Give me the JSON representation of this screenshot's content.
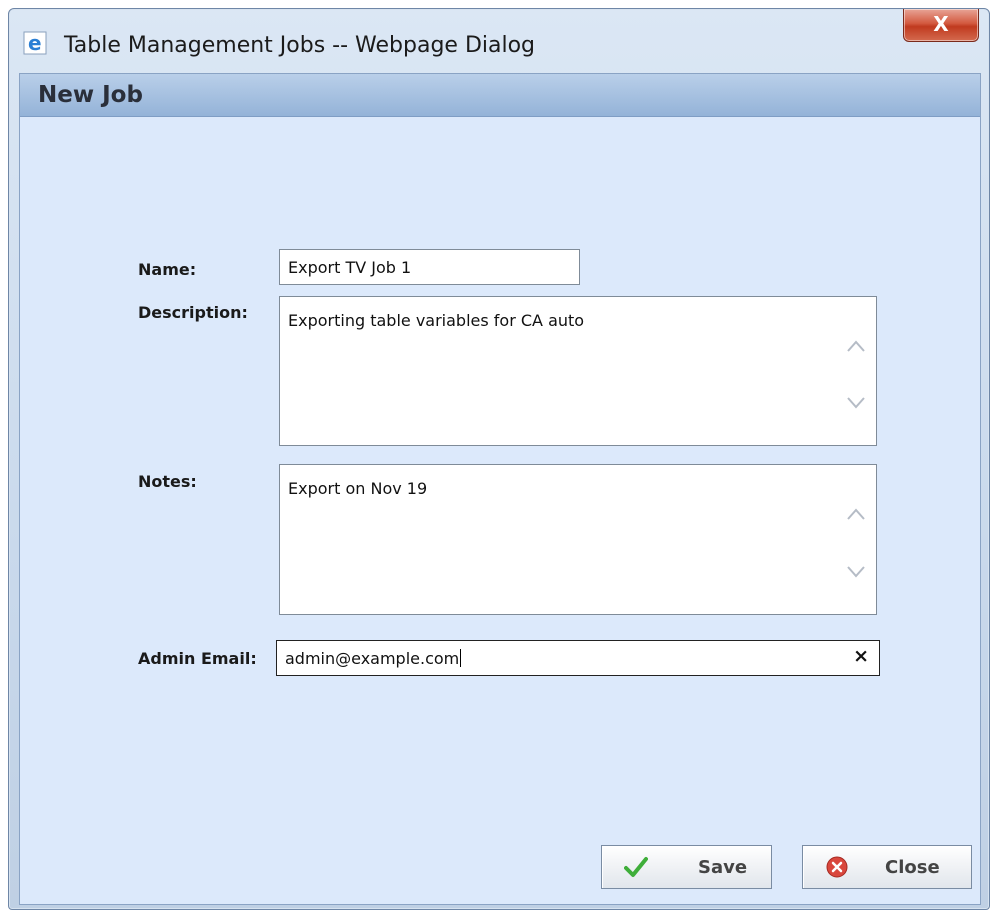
{
  "window": {
    "title": "Table Management Jobs -- Webpage Dialog",
    "close_glyph": "X"
  },
  "dialog": {
    "header": "New Job"
  },
  "form": {
    "name_label": "Name:",
    "name_value": "Export TV Job 1",
    "description_label": "Description:",
    "description_value": "Exporting table variables for CA auto",
    "notes_label": "Notes:",
    "notes_value": "Export on Nov 19",
    "admin_email_label": "Admin Email:",
    "admin_email_value": "admin@example.com",
    "clear_glyph": "×"
  },
  "buttons": {
    "save_label": "Save",
    "close_label": "Close"
  },
  "icons": {
    "window_icon": "ie-icon",
    "save_icon": "checkmark-icon",
    "close_icon": "cancel-circle-icon"
  },
  "colors": {
    "client_background": "#dce9fb",
    "header_band": "#a9c3e3",
    "close_button": "#c9482d",
    "save_check": "#3fae3a",
    "close_circle": "#d9473d"
  }
}
